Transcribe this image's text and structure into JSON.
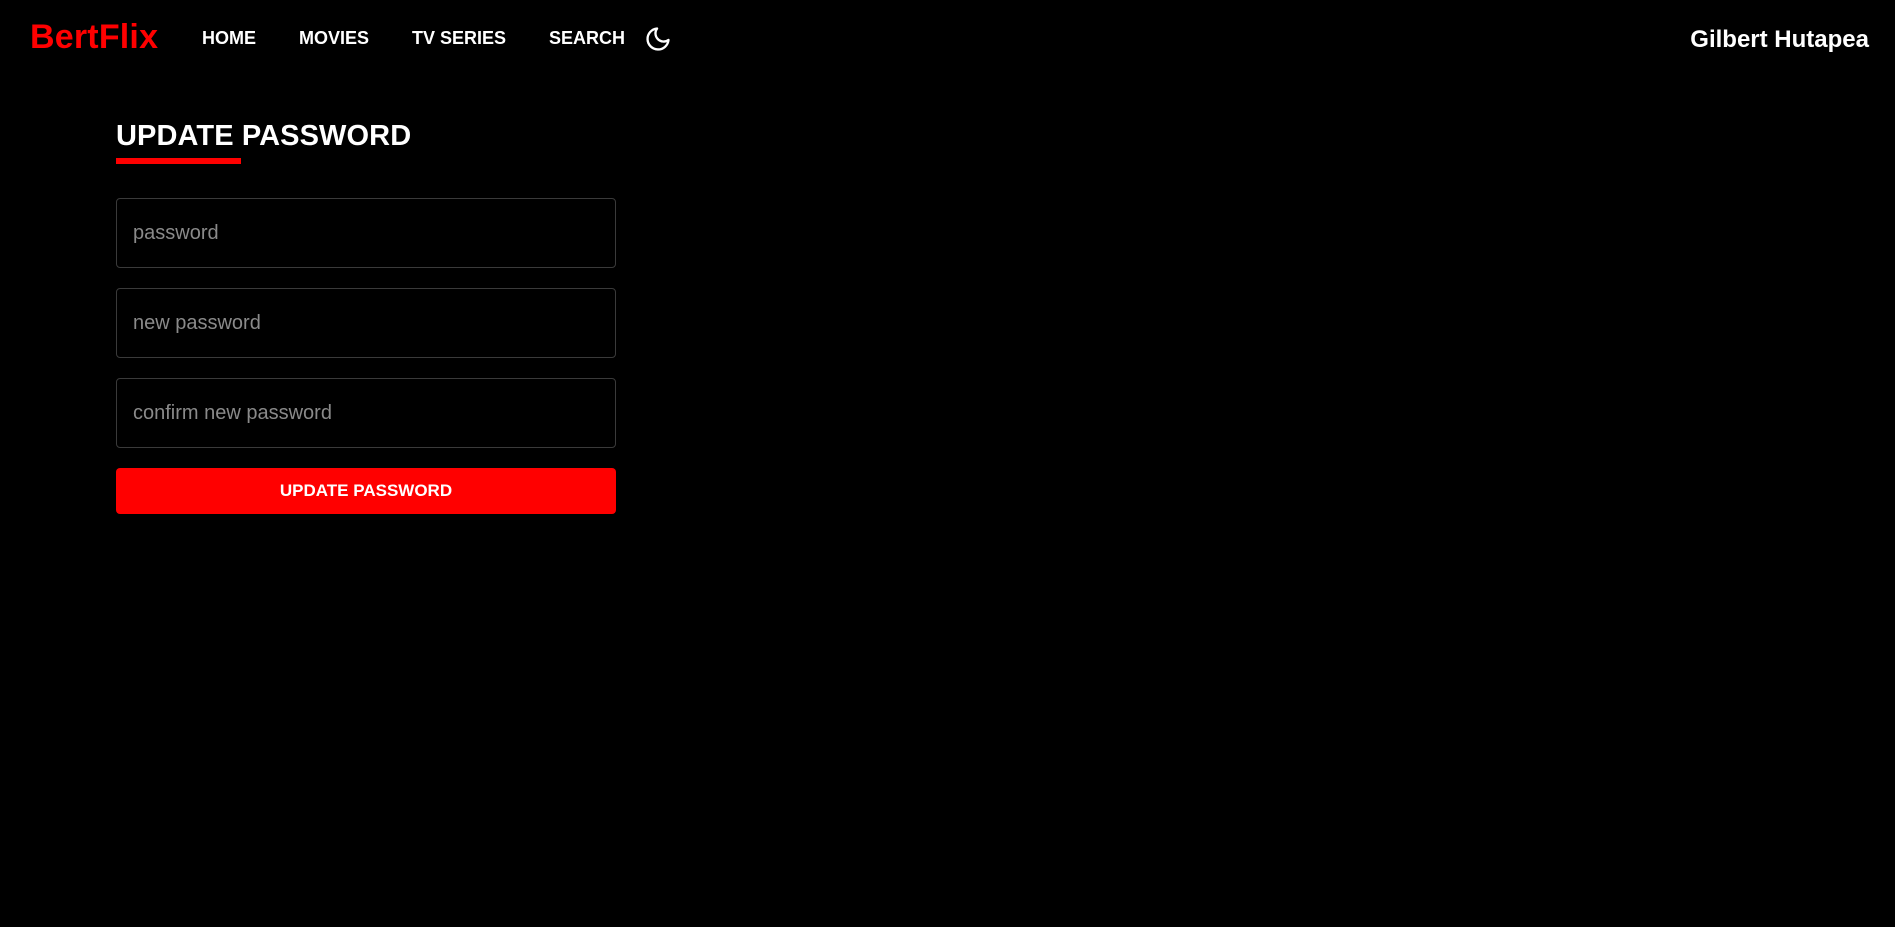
{
  "brand": {
    "name": "BertFlix",
    "color": "#ff0000"
  },
  "nav": {
    "items": [
      {
        "label": "HOME"
      },
      {
        "label": "MOVIES"
      },
      {
        "label": "TV SERIES"
      },
      {
        "label": "SEARCH"
      }
    ],
    "theme_toggle_icon": "moon-icon"
  },
  "user": {
    "name": "Gilbert Hutapea"
  },
  "form": {
    "title": "UPDATE PASSWORD",
    "fields": [
      {
        "placeholder": "password",
        "value": ""
      },
      {
        "placeholder": "new password",
        "value": ""
      },
      {
        "placeholder": "confirm new password",
        "value": ""
      }
    ],
    "submit_label": "UPDATE PASSWORD"
  },
  "colors": {
    "background": "#000000",
    "accent": "#ff0000",
    "text": "#ffffff",
    "placeholder": "#8a8a8a",
    "border": "#3a3a3a"
  }
}
